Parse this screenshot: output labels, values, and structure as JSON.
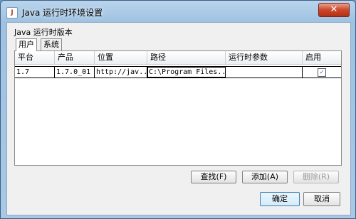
{
  "window": {
    "title": "Java 运行时环境设置",
    "close_label": "✕",
    "app_icon_label": "J"
  },
  "section": {
    "label": "Java 运行时版本"
  },
  "tabs": [
    {
      "label": "用户"
    },
    {
      "label": "系统"
    }
  ],
  "table": {
    "headers": [
      "平台",
      "产品",
      "位置",
      "路径",
      "运行时参数",
      "启用"
    ],
    "rows": [
      {
        "platform": "1.7",
        "product": "1.7.0_01",
        "location": "http://jav...",
        "path": "C:\\Program Files...",
        "params": "",
        "enabled": true,
        "check_glyph": "✓"
      }
    ]
  },
  "buttons": {
    "find": "查找(F)",
    "add": "添加(A)",
    "delete": "删除(R)",
    "ok": "确定",
    "cancel": "取消"
  }
}
